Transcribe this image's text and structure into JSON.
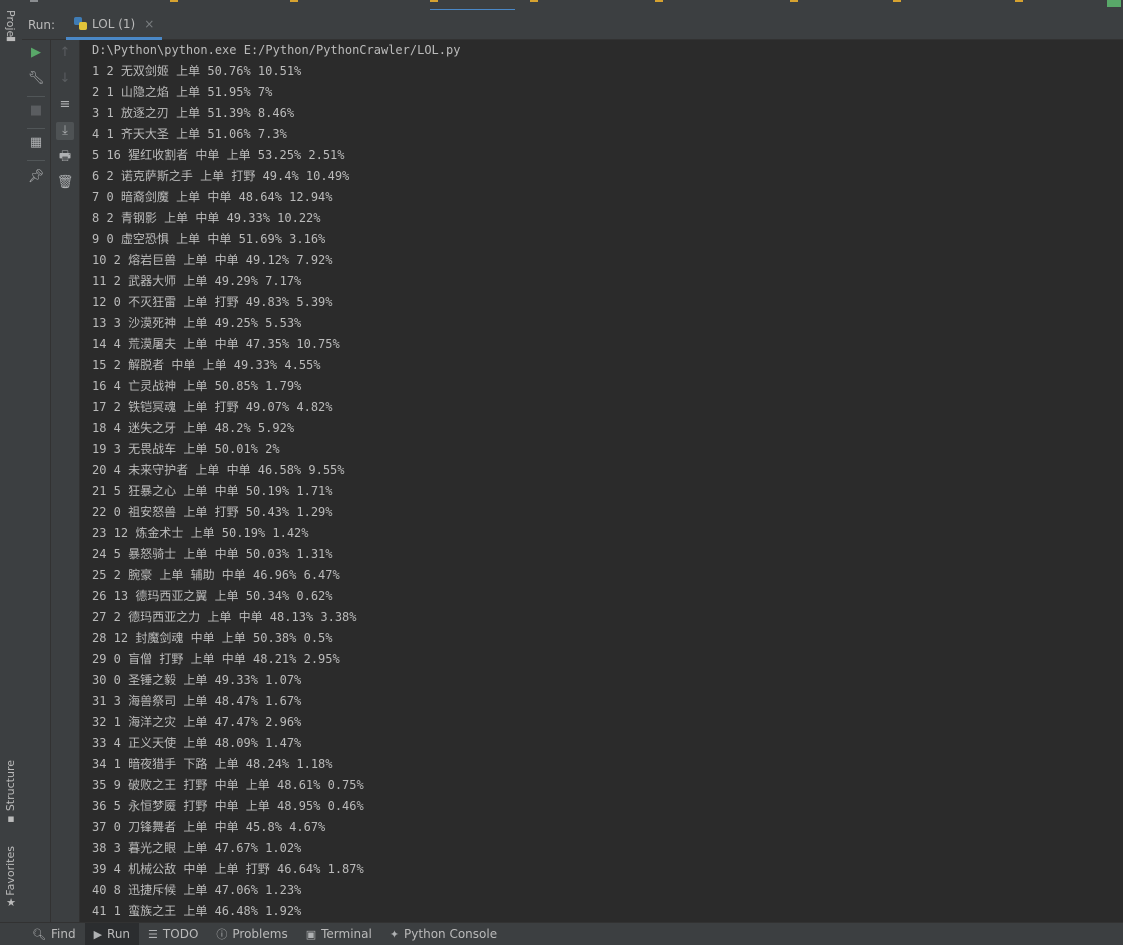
{
  "left_strip": {
    "project_label": "Proje",
    "structure_label": "Structure",
    "favorites_label": "Favorites"
  },
  "run_panel": {
    "run_label": "Run:",
    "tab_label": "LOL (1)",
    "close_glyph": "×"
  },
  "console": {
    "lines": [
      "D:\\Python\\python.exe E:/Python/PythonCrawler/LOL.py",
      "1 2 无双剑姬 上单 50.76% 10.51%",
      "2 1 山隐之焰 上单 51.95% 7%",
      "3 1 放逐之刃 上单 51.39% 8.46%",
      "4 1 齐天大圣 上单 51.06% 7.3%",
      "5 16 猩红收割者 中单 上单 53.25% 2.51%",
      "6 2 诺克萨斯之手 上单 打野 49.4% 10.49%",
      "7 0 暗裔剑魔 上单 中单 48.64% 12.94%",
      "8 2 青钢影 上单 中单 49.33% 10.22%",
      "9 0 虚空恐惧 上单 中单 51.69% 3.16%",
      "10 2 熔岩巨兽 上单 中单 49.12% 7.92%",
      "11 2 武器大师 上单 49.29% 7.17%",
      "12 0 不灭狂雷 上单 打野 49.83% 5.39%",
      "13 3 沙漠死神 上单 49.25% 5.53%",
      "14 4 荒漠屠夫 上单 中单 47.35% 10.75%",
      "15 2 解脱者 中单 上单 49.33% 4.55%",
      "16 4 亡灵战神 上单 50.85% 1.79%",
      "17 2 铁铠冥魂 上单 打野 49.07% 4.82%",
      "18 4 迷失之牙 上单 48.2% 5.92%",
      "19 3 无畏战车 上单 50.01% 2%",
      "20 4 未来守护者 上单 中单 46.58% 9.55%",
      "21 5 狂暴之心 上单 中单 50.19% 1.71%",
      "22 0 祖安怒兽 上单 打野 50.43% 1.29%",
      "23 12 炼金术士 上单 50.19% 1.42%",
      "24 5 暴怒骑士 上单 中单 50.03% 1.31%",
      "25 2 腕豪 上单 辅助 中单 46.96% 6.47%",
      "26 13 德玛西亚之翼 上单 50.34% 0.62%",
      "27 2 德玛西亚之力 上单 中单 48.13% 3.38%",
      "28 12 封魔剑魂 中单 上单 50.38% 0.5%",
      "29 0 盲僧 打野 上单 中单 48.21% 2.95%",
      "30 0 圣锤之毅 上单 49.33% 1.07%",
      "31 3 海兽祭司 上单 48.47% 1.67%",
      "32 1 海洋之灾 上单 47.47% 2.96%",
      "33 4 正义天使 上单 48.09% 1.47%",
      "34 1 暗夜猎手 下路 上单 48.24% 1.18%",
      "35 9 破败之王 打野 中单 上单 48.61% 0.75%",
      "36 5 永恒梦魇 打野 中单 上单 48.95% 0.46%",
      "37 0 刀锋舞者 上单 中单 45.8% 4.67%",
      "38 3 暮光之眼 上单 47.67% 1.02%",
      "39 4 机械公敌 中单 上单 打野 46.64% 1.87%",
      "40 8 迅捷斥候 上单 47.06% 1.23%",
      "41 1 蛮族之王 上单 46.48% 1.92%"
    ]
  },
  "bottom_bar": {
    "find": "Find",
    "run": "Run",
    "todo": "TODO",
    "problems": "Problems",
    "terminal": "Terminal",
    "python_console": "Python Console"
  },
  "colors": {
    "background": "#2b2b2b",
    "panel": "#3c3f41",
    "text": "#bbbbbb",
    "accent": "#4a88c7",
    "run_green": "#59a869"
  }
}
